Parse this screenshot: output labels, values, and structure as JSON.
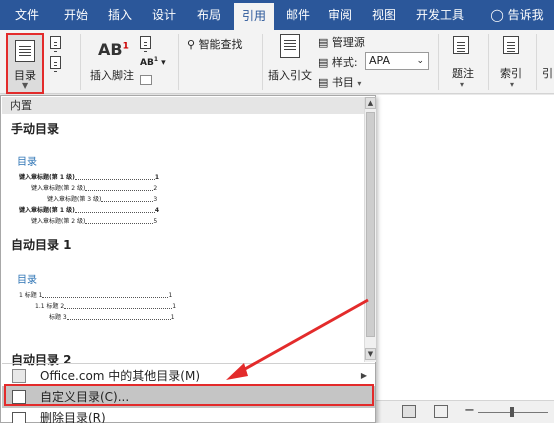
{
  "tabs": [
    "文件",
    "开始",
    "插入",
    "设计",
    "布局",
    "引用",
    "邮件",
    "审阅",
    "视图",
    "开发工具",
    "告诉我"
  ],
  "active_tab": "引用",
  "ribbon": {
    "toc_label": "目录",
    "footnote_label": "插入脚注",
    "smart_lookup": "智能查找",
    "insert_citation": "插入引文",
    "manage_sources": "管理源",
    "style_label": "样式:",
    "style_value": "APA",
    "bibliography": "书目",
    "caption_label": "题注",
    "index_label": "索引",
    "cutoff_label": "引"
  },
  "panel": {
    "header": "内置",
    "manual_title": "手动目录",
    "manual_toc": {
      "heading": "目录",
      "lines": [
        {
          "text": "键入章标题(第 1 级)",
          "page": "1",
          "bold": true
        },
        {
          "text": "键入章标题(第 2 级)",
          "page": "2",
          "bold": false
        },
        {
          "text": "键入章标题(第 3 级)",
          "page": "3",
          "bold": false
        },
        {
          "text": "键入章标题(第 1 级)",
          "page": "4",
          "bold": true
        },
        {
          "text": "键入章标题(第 2 级)",
          "page": "5",
          "bold": false
        }
      ]
    },
    "auto1_title": "自动目录 1",
    "auto1_toc": {
      "heading": "目录",
      "lines": [
        {
          "text": "1 标题 1",
          "page": "1"
        },
        {
          "text": "1.1 标题 2",
          "page": "1"
        },
        {
          "text": "标题 3",
          "page": "1"
        }
      ]
    },
    "auto2_title": "自动目录 2",
    "menu": {
      "more_online": "Office.com 中的其他目录(M)",
      "custom_toc": "自定义目录(C)...",
      "remove_toc": "删除目录(R)"
    }
  },
  "colors": {
    "ribbon_blue": "#2b579a",
    "highlight_red": "#e32b2b",
    "toc_heading_blue": "#2e74b5"
  }
}
